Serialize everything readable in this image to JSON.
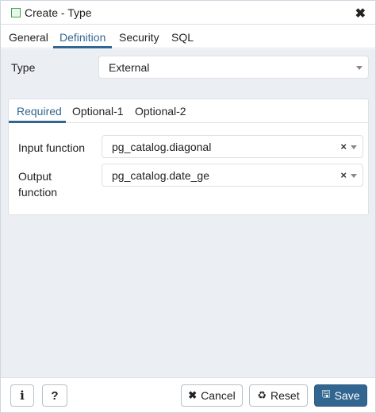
{
  "dialog": {
    "title": "Create - Type",
    "close_icon": "close-icon"
  },
  "tabs": [
    {
      "label": "General"
    },
    {
      "label": "Definition",
      "active": true
    },
    {
      "label": "Security"
    },
    {
      "label": "SQL"
    }
  ],
  "type_field": {
    "label": "Type",
    "value": "External"
  },
  "subtabs": [
    {
      "label": "Required",
      "active": true
    },
    {
      "label": "Optional-1"
    },
    {
      "label": "Optional-2"
    }
  ],
  "input_function": {
    "label": "Input function",
    "value": "pg_catalog.diagonal"
  },
  "output_function": {
    "label_line1": "Output",
    "label_line2": "function",
    "value": "pg_catalog.date_ge"
  },
  "footer": {
    "info_label": "i",
    "help_label": "?",
    "cancel_label": "Cancel",
    "reset_label": "Reset",
    "save_label": "Save"
  },
  "colors": {
    "accent": "#326690",
    "content_bg": "#ebeef3"
  }
}
